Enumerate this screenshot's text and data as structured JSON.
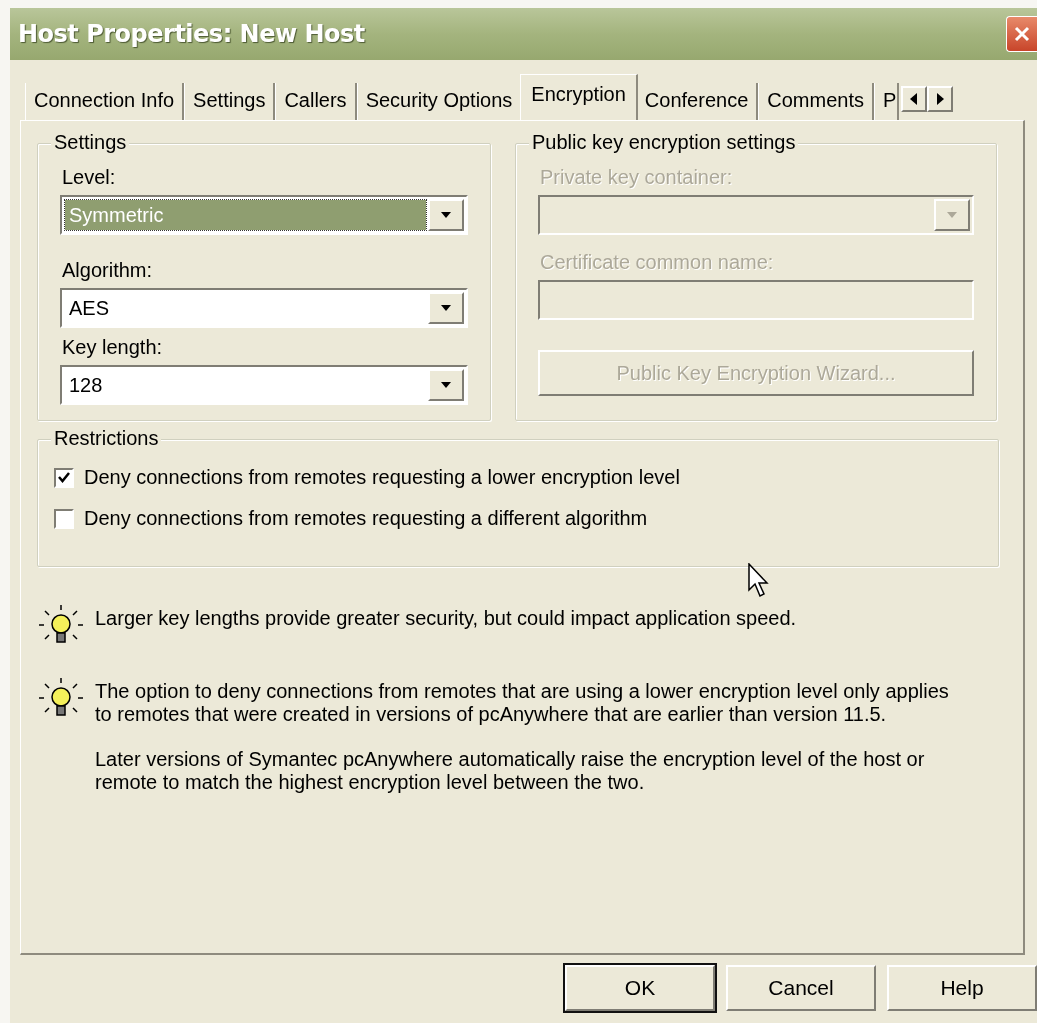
{
  "window": {
    "title": "Host Properties: New Host"
  },
  "tabs": [
    {
      "label": "Connection Info",
      "selected": false
    },
    {
      "label": "Settings",
      "selected": false
    },
    {
      "label": "Callers",
      "selected": false
    },
    {
      "label": "Security Options",
      "selected": false
    },
    {
      "label": "Encryption",
      "selected": true
    },
    {
      "label": "Conference",
      "selected": false
    },
    {
      "label": "Comments",
      "selected": false
    },
    {
      "label": "P",
      "selected": false
    }
  ],
  "settings": {
    "title": "Settings",
    "fields": [
      {
        "label": "Level:",
        "value": "Symmetric",
        "focused": true
      },
      {
        "label": "Algorithm:",
        "value": "AES",
        "focused": false
      },
      {
        "label": "Key length:",
        "value": "128",
        "focused": false
      }
    ]
  },
  "public_key": {
    "title": "Public key encryption settings",
    "disabled": true,
    "container_label": "Private key container:",
    "name_label": "Certificate common name:",
    "wizard_button": "Public Key Encryption Wizard..."
  },
  "restrictions": {
    "title": "Restrictions",
    "options": [
      {
        "label": "Deny connections from remotes requesting a lower encryption level",
        "checked": true
      },
      {
        "label": "Deny connections from remotes requesting a different algorithm",
        "checked": false
      }
    ]
  },
  "tips": [
    {
      "paragraphs": [
        "Larger key lengths provide greater security, but could impact application speed."
      ]
    },
    {
      "paragraphs": [
        "The option to deny connections from remotes that are using a lower encryption level only applies to remotes that were created in versions of pcAnywhere that are earlier than version 11.5.",
        "Later versions of Symantec pcAnywhere automatically raise the encryption level of the host or remote to match the highest encryption level between the two."
      ]
    }
  ],
  "buttons": [
    {
      "label": "OK",
      "default": true
    },
    {
      "label": "Cancel",
      "default": false
    },
    {
      "label": "Help",
      "default": false
    }
  ]
}
